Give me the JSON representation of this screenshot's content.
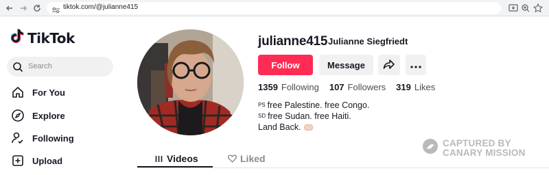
{
  "browser": {
    "url": "tiktok.com/@julianne415",
    "icons": [
      "back-icon",
      "forward-icon",
      "reload-icon",
      "site-info-icon",
      "install-icon",
      "zoom-icon",
      "bookmark-star-icon"
    ]
  },
  "sidebar": {
    "logo_text": "TikTok",
    "search_placeholder": "Search",
    "items": [
      {
        "label": "For You",
        "icon": "home-icon"
      },
      {
        "label": "Explore",
        "icon": "compass-icon"
      },
      {
        "label": "Following",
        "icon": "following-icon"
      },
      {
        "label": "Upload",
        "icon": "upload-icon"
      }
    ]
  },
  "profile": {
    "username": "julianne415",
    "nickname": "Julianne Siegfriedt",
    "follow_label": "Follow",
    "message_label": "Message",
    "stats": {
      "following": "1359",
      "following_label": "Following",
      "followers": "107",
      "followers_label": "Followers",
      "likes": "319",
      "likes_label": "Likes"
    },
    "bio": {
      "line1_flag": "PS",
      "line1": "free Palestine. free Congo.",
      "line2_flag": "SD",
      "line2": "free Sudan. free Haiti.",
      "line3": "Land Back."
    }
  },
  "tabs": [
    {
      "label": "Videos",
      "active": true
    },
    {
      "label": "Liked",
      "active": false
    }
  ],
  "watermark": {
    "line1": "CAPTURED BY",
    "line2": "CANARY MISSION"
  },
  "colors": {
    "accent": "#fe2c55",
    "text": "#161823",
    "muted": "#8a8b91"
  }
}
